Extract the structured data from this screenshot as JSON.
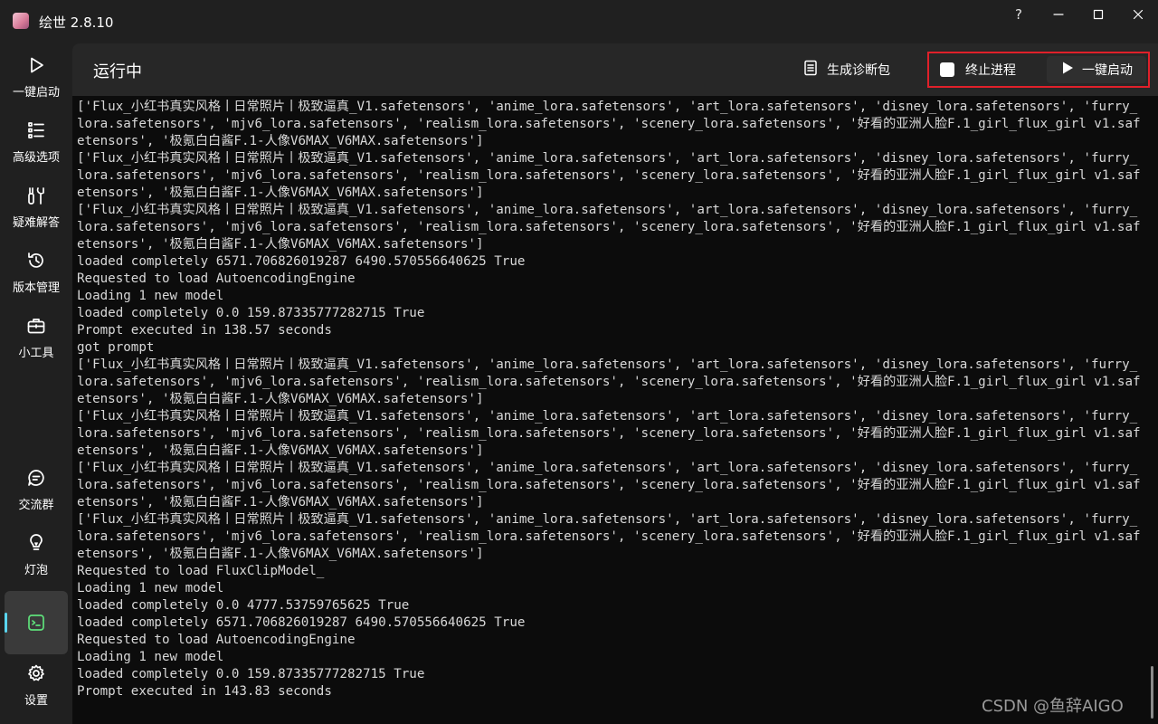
{
  "window": {
    "title": "绘世 2.8.10",
    "controls": [
      "?",
      "—",
      "☐",
      "✕"
    ]
  },
  "sidebar": {
    "items": [
      {
        "label": "一键启动",
        "icon": "play-icon"
      },
      {
        "label": "高级选项",
        "icon": "list-icon"
      },
      {
        "label": "疑难解答",
        "icon": "tools-icon"
      },
      {
        "label": "版本管理",
        "icon": "history-icon"
      },
      {
        "label": "小工具",
        "icon": "toolbox-icon"
      },
      {
        "label": "交流群",
        "icon": "chat-icon"
      },
      {
        "label": "灯泡",
        "icon": "lightbulb-icon"
      },
      {
        "label": "",
        "icon": "console-icon",
        "active": true
      },
      {
        "label": "设置",
        "icon": "gear-icon"
      }
    ]
  },
  "header": {
    "title": "运行中",
    "diagnose_label": "生成诊断包",
    "terminate_label": "终止进程",
    "start_label": "一键启动"
  },
  "console": {
    "lines": [
      "['Flux_小红书真实风格丨日常照片丨极致逼真_V1.safetensors', 'anime_lora.safetensors', 'art_lora.safetensors', 'disney_lora.safetensors', 'furry_lora.safetensors', 'mjv6_lora.safetensors', 'realism_lora.safetensors', 'scenery_lora.safetensors', '好看的亚洲人脸F.1_girl_flux_girl v1.safetensors', '极氪白白酱F.1-人像V6MAX_V6MAX.safetensors']",
      "['Flux_小红书真实风格丨日常照片丨极致逼真_V1.safetensors', 'anime_lora.safetensors', 'art_lora.safetensors', 'disney_lora.safetensors', 'furry_lora.safetensors', 'mjv6_lora.safetensors', 'realism_lora.safetensors', 'scenery_lora.safetensors', '好看的亚洲人脸F.1_girl_flux_girl v1.safetensors', '极氪白白酱F.1-人像V6MAX_V6MAX.safetensors']",
      "['Flux_小红书真实风格丨日常照片丨极致逼真_V1.safetensors', 'anime_lora.safetensors', 'art_lora.safetensors', 'disney_lora.safetensors', 'furry_lora.safetensors', 'mjv6_lora.safetensors', 'realism_lora.safetensors', 'scenery_lora.safetensors', '好看的亚洲人脸F.1_girl_flux_girl v1.safetensors', '极氪白白酱F.1-人像V6MAX_V6MAX.safetensors']",
      "loaded completely 6571.706826019287 6490.570556640625 True",
      "Requested to load AutoencodingEngine",
      "Loading 1 new model",
      "loaded completely 0.0 159.87335777282715 True",
      "Prompt executed in 138.57 seconds",
      "got prompt",
      "['Flux_小红书真实风格丨日常照片丨极致逼真_V1.safetensors', 'anime_lora.safetensors', 'art_lora.safetensors', 'disney_lora.safetensors', 'furry_lora.safetensors', 'mjv6_lora.safetensors', 'realism_lora.safetensors', 'scenery_lora.safetensors', '好看的亚洲人脸F.1_girl_flux_girl v1.safetensors', '极氪白白酱F.1-人像V6MAX_V6MAX.safetensors']",
      "['Flux_小红书真实风格丨日常照片丨极致逼真_V1.safetensors', 'anime_lora.safetensors', 'art_lora.safetensors', 'disney_lora.safetensors', 'furry_lora.safetensors', 'mjv6_lora.safetensors', 'realism_lora.safetensors', 'scenery_lora.safetensors', '好看的亚洲人脸F.1_girl_flux_girl v1.safetensors', '极氪白白酱F.1-人像V6MAX_V6MAX.safetensors']",
      "['Flux_小红书真实风格丨日常照片丨极致逼真_V1.safetensors', 'anime_lora.safetensors', 'art_lora.safetensors', 'disney_lora.safetensors', 'furry_lora.safetensors', 'mjv6_lora.safetensors', 'realism_lora.safetensors', 'scenery_lora.safetensors', '好看的亚洲人脸F.1_girl_flux_girl v1.safetensors', '极氪白白酱F.1-人像V6MAX_V6MAX.safetensors']",
      "['Flux_小红书真实风格丨日常照片丨极致逼真_V1.safetensors', 'anime_lora.safetensors', 'art_lora.safetensors', 'disney_lora.safetensors', 'furry_lora.safetensors', 'mjv6_lora.safetensors', 'realism_lora.safetensors', 'scenery_lora.safetensors', '好看的亚洲人脸F.1_girl_flux_girl v1.safetensors', '极氪白白酱F.1-人像V6MAX_V6MAX.safetensors']",
      "Requested to load FluxClipModel_",
      "Loading 1 new model",
      "loaded completely 0.0 4777.53759765625 True",
      "loaded completely 6571.706826019287 6490.570556640625 True",
      "Requested to load AutoencodingEngine",
      "Loading 1 new model",
      "loaded completely 0.0 159.87335777282715 True",
      "Prompt executed in 143.83 seconds"
    ]
  },
  "watermark": "CSDN @鱼辞AIGO",
  "colors": {
    "accent": "#5ad6f0",
    "highlight_border": "#e0202a",
    "console_bg": "#0c0c0c"
  }
}
